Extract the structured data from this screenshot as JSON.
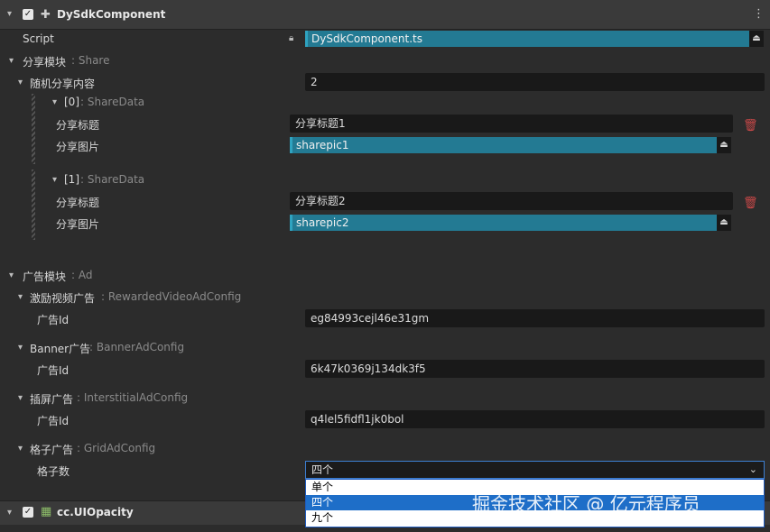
{
  "component": {
    "name": "DySdkComponent",
    "script_label": "Script",
    "script_value": "DySdkComponent.ts"
  },
  "share": {
    "label": "分享模块",
    "type": ": Share",
    "random_label": "随机分享内容",
    "random_count": "2",
    "items": [
      {
        "index_label": "[0]",
        "type": ": ShareData",
        "title_label": "分享标题",
        "title_value": "分享标题1",
        "pic_label": "分享图片",
        "pic_value": "sharepic1"
      },
      {
        "index_label": "[1]",
        "type": ": ShareData",
        "title_label": "分享标题",
        "title_value": "分享标题2",
        "pic_label": "分享图片",
        "pic_value": "sharepic2"
      }
    ]
  },
  "ad": {
    "label": "广告模块",
    "type": ": Ad",
    "rewarded": {
      "label": "激励视频广告",
      "type": ": RewardedVideoAdConfig",
      "id_label": "广告Id",
      "id_value": "eg84993cejl46e31gm"
    },
    "banner": {
      "label": "Banner广告",
      "type": ": BannerAdConfig",
      "id_label": "广告Id",
      "id_value": "6k47k0369j134dk3f5"
    },
    "interstitial": {
      "label": "插屏广告",
      "type": ": InterstitialAdConfig",
      "id_label": "广告Id",
      "id_value": "q4lel5fidfl1jk0bol"
    },
    "grid": {
      "label": "格子广告",
      "type": ": GridAdConfig",
      "count_label": "格子数",
      "selected": "四个",
      "options": [
        "单个",
        "四个",
        "九个"
      ]
    }
  },
  "footer": {
    "component_name": "cc.UIOpacity"
  },
  "watermark": "掘金技术社区 @ 亿元程序员",
  "colors": {
    "asset_bg": "#237a93",
    "selected_option": "#1e6ec8",
    "delete_icon": "#c94848"
  }
}
